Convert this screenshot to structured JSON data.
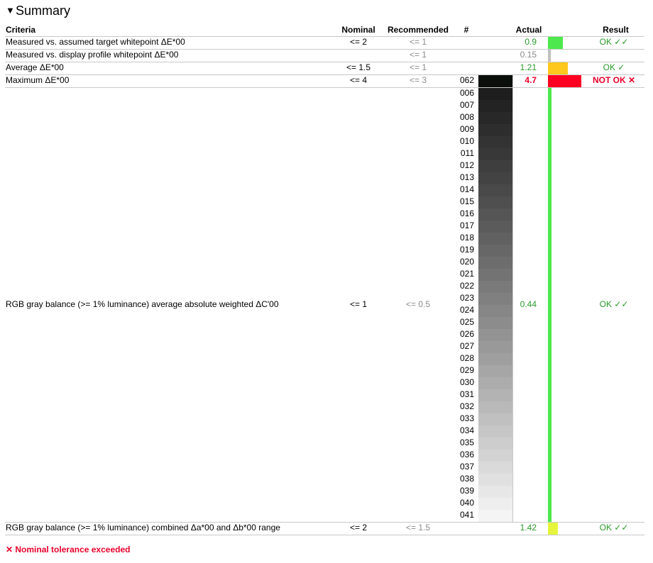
{
  "summary": {
    "title": "Summary",
    "toggle_icon": "triangle-down-icon"
  },
  "columns": {
    "criteria": "Criteria",
    "nominal": "Nominal",
    "recommended": "Recommended",
    "number": "#",
    "actual": "Actual",
    "result": "Result"
  },
  "rows": [
    {
      "criteria": "Measured vs. assumed target whitepoint ΔE*00",
      "nominal": "<= 2",
      "recommended": "<= 1",
      "actual": "0.9",
      "result": "OK ✓✓",
      "status": "ok",
      "bar_color": "#4de84d",
      "bar_fill": 0.45
    },
    {
      "criteria": "Measured vs. display profile whitepoint ΔE*00",
      "nominal": "",
      "recommended": "<= 1",
      "actual": "0.15",
      "result": "",
      "status": "info",
      "bar_color": "#c0c0c0",
      "bar_fill": 0.075
    },
    {
      "criteria": "Average ΔE*00",
      "nominal": "<= 1.5",
      "recommended": "<= 1",
      "actual": "1.21",
      "result": "OK ✓",
      "status": "ok",
      "bar_color": "#ffc81e",
      "bar_fill": 0.6
    },
    {
      "criteria": "Maximum ΔE*00",
      "nominal": "<= 4",
      "recommended": "<= 3",
      "number": "062",
      "actual": "4.7",
      "result": "NOT OK ✕",
      "status": "fail",
      "bar_color": "#ff0022",
      "bar_fill": 1.0
    },
    {
      "criteria": "RGB gray balance (>= 1% luminance) average absolute weighted ΔC'00",
      "nominal": "<= 1",
      "recommended": "<= 0.5",
      "actual": "0.44",
      "result": "OK ✓✓",
      "status": "ok",
      "bar_color": "#4de84d",
      "bar_fill": 0.1
    },
    {
      "criteria": "RGB gray balance (>= 1% luminance) combined Δa*00 and Δb*00 range",
      "nominal": "<= 2",
      "recommended": "<= 1.5",
      "actual": "1.42",
      "result": "OK ✓✓",
      "status": "ok",
      "bar_color": "#e6f53c",
      "bar_fill": 0.3
    }
  ],
  "max_patch_color": "#0b0f0b",
  "gray_patches": [
    {
      "number": "006",
      "color": "#1e1e1e"
    },
    {
      "number": "007",
      "color": "#232323"
    },
    {
      "number": "008",
      "color": "#282828"
    },
    {
      "number": "009",
      "color": "#2d2d2d"
    },
    {
      "number": "010",
      "color": "#333333"
    },
    {
      "number": "011",
      "color": "#383838"
    },
    {
      "number": "012",
      "color": "#3e3e3e"
    },
    {
      "number": "013",
      "color": "#434343"
    },
    {
      "number": "014",
      "color": "#494949"
    },
    {
      "number": "015",
      "color": "#4f4f4f"
    },
    {
      "number": "016",
      "color": "#555555"
    },
    {
      "number": "017",
      "color": "#5b5b5b"
    },
    {
      "number": "018",
      "color": "#616161"
    },
    {
      "number": "019",
      "color": "#676767"
    },
    {
      "number": "020",
      "color": "#6d6d6d"
    },
    {
      "number": "021",
      "color": "#737373"
    },
    {
      "number": "022",
      "color": "#7a7a7a"
    },
    {
      "number": "023",
      "color": "#808080"
    },
    {
      "number": "024",
      "color": "#868686"
    },
    {
      "number": "025",
      "color": "#8c8c8c"
    },
    {
      "number": "026",
      "color": "#939393"
    },
    {
      "number": "027",
      "color": "#999999"
    },
    {
      "number": "028",
      "color": "#9f9f9f"
    },
    {
      "number": "029",
      "color": "#a6a6a6"
    },
    {
      "number": "030",
      "color": "#acacac"
    },
    {
      "number": "031",
      "color": "#b3b3b3"
    },
    {
      "number": "032",
      "color": "#b9b9b9"
    },
    {
      "number": "033",
      "color": "#c0c0c0"
    },
    {
      "number": "034",
      "color": "#c6c6c6"
    },
    {
      "number": "035",
      "color": "#cdcdcd"
    },
    {
      "number": "036",
      "color": "#d3d3d3"
    },
    {
      "number": "037",
      "color": "#dadada"
    },
    {
      "number": "038",
      "color": "#e0e0e0"
    },
    {
      "number": "039",
      "color": "#e7e7e7"
    },
    {
      "number": "040",
      "color": "#eeeeee"
    },
    {
      "number": "041",
      "color": "#f4f4f4"
    }
  ],
  "footer": {
    "note": "✕ Nominal tolerance exceeded"
  },
  "colors": {
    "ok": "#2a9a2a",
    "fail": "#e8002a",
    "grey": "#8a8a8a",
    "rule": "#c8c8c8"
  }
}
